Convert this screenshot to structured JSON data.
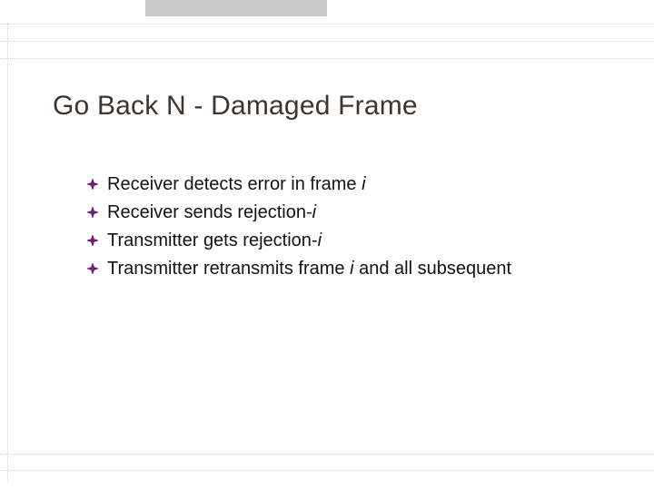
{
  "title": "Go Back N - Damaged Frame",
  "bullets": [
    {
      "pre": "Receiver detects error in frame ",
      "var": "i",
      "post": ""
    },
    {
      "pre": "Receiver sends rejection-",
      "var": "i",
      "post": ""
    },
    {
      "pre": "Transmitter gets rejection-",
      "var": "i",
      "post": ""
    },
    {
      "pre": "Transmitter retransmits frame ",
      "var": "i",
      "post": " and all subsequent"
    }
  ],
  "colors": {
    "bullet_fill": "#7a1a7a",
    "bullet_stroke": "#5a145a"
  }
}
